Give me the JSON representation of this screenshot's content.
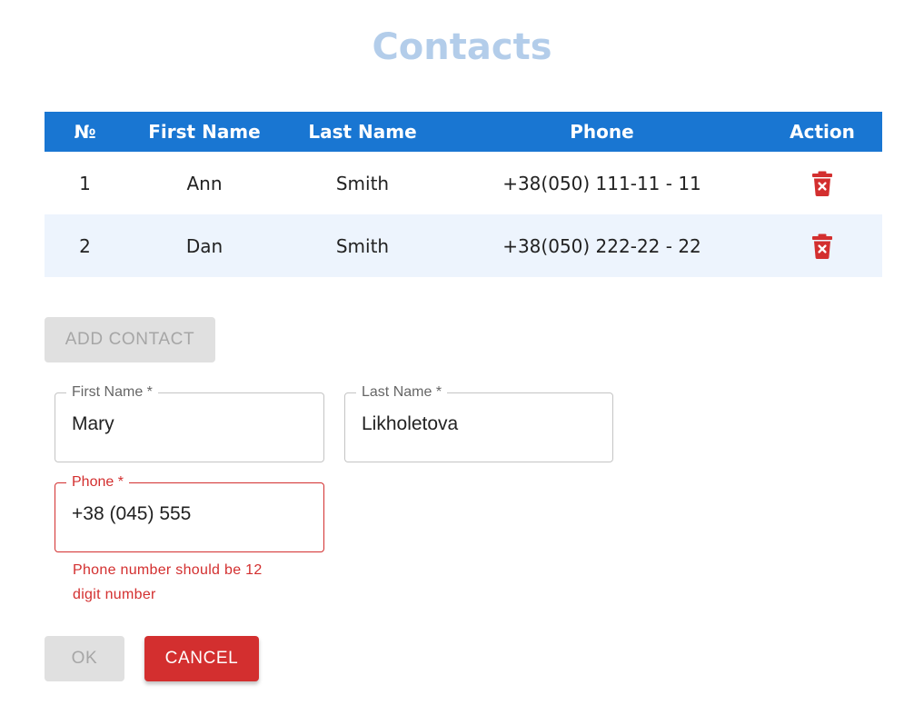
{
  "title": "Contacts",
  "table": {
    "headers": [
      "№",
      "First Name",
      "Last Name",
      "Phone",
      "Action"
    ],
    "rows": [
      {
        "num": "1",
        "first": "Ann",
        "last": "Smith",
        "phone": "+38(050) 111-11 - 11",
        "action_icon": "trash-icon"
      },
      {
        "num": "2",
        "first": "Dan",
        "last": "Smith",
        "phone": "+38(050) 222-22 - 22",
        "action_icon": "trash-icon"
      }
    ]
  },
  "buttons": {
    "add_contact": "ADD CONTACT",
    "ok": "OK",
    "cancel": "CANCEL"
  },
  "form": {
    "first_name": {
      "label": "First Name *",
      "value": "Mary"
    },
    "last_name": {
      "label": "Last Name *",
      "value": "Likholetova"
    },
    "phone": {
      "label": "Phone *",
      "value": "+38 (045) 555",
      "error": "Phone number should be 12 digit number"
    }
  },
  "colors": {
    "primary": "#1976d2",
    "title": "#b3cdea",
    "error": "#d32f2f",
    "row_alt": "#edf4fd",
    "disabled_bg": "#e0e0e0",
    "disabled_text": "#a6a6a6"
  }
}
